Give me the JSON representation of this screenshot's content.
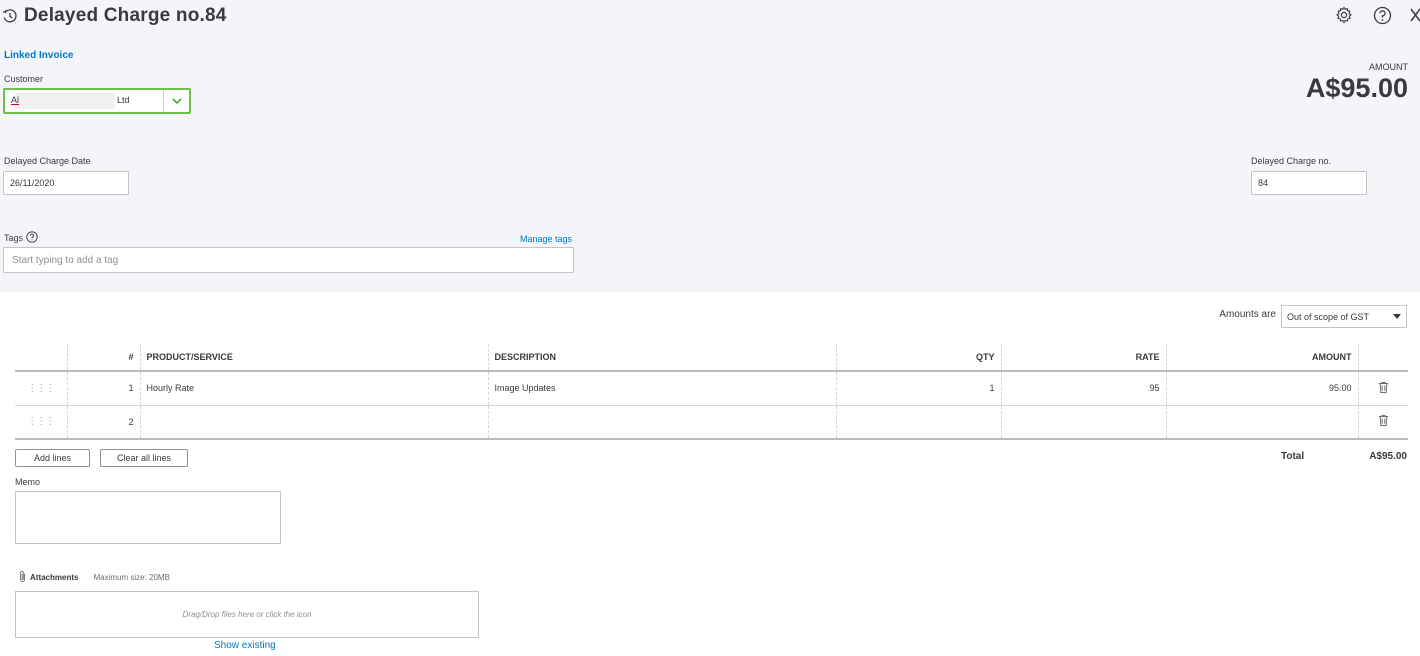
{
  "title": "Delayed Charge no.84",
  "linked_invoice": "Linked Invoice",
  "customer": {
    "label": "Customer",
    "value_start": "Al",
    "value_end": "Ltd"
  },
  "amount": {
    "label": "AMOUNT",
    "value": "A$95.00"
  },
  "charge_date": {
    "label": "Delayed Charge Date",
    "value": "26/11/2020"
  },
  "charge_no": {
    "label": "Delayed Charge no.",
    "value": "84"
  },
  "tags": {
    "label": "Tags",
    "manage": "Manage tags",
    "placeholder": "Start typing to add a tag"
  },
  "amounts_are": {
    "label": "Amounts are",
    "value": "Out of scope of GST"
  },
  "table": {
    "headers": {
      "num": "#",
      "product": "PRODUCT/SERVICE",
      "description": "DESCRIPTION",
      "qty": "QTY",
      "rate": "RATE",
      "amount": "AMOUNT"
    },
    "rows": [
      {
        "num": "1",
        "product": "Hourly Rate",
        "description": "Image Updates",
        "qty": "1",
        "rate": "95",
        "amount": "95.00"
      },
      {
        "num": "2",
        "product": "",
        "description": "",
        "qty": "",
        "rate": "",
        "amount": ""
      }
    ]
  },
  "buttons": {
    "add_lines": "Add lines",
    "clear_lines": "Clear all lines"
  },
  "total": {
    "label": "Total",
    "value": "A$95.00"
  },
  "memo": {
    "label": "Memo"
  },
  "attachments": {
    "title": "Attachments",
    "max_size": "Maximum size: 20MB",
    "drop_text": "Drag/Drop files here or click the icon",
    "show_existing": "Show existing"
  },
  "icons": {
    "history": "history-icon",
    "settings": "gear-icon",
    "help": "help-icon",
    "close": "close-icon",
    "trash": "trash-icon",
    "drag": "drag-handle-icon",
    "paperclip": "paperclip-icon"
  },
  "colors": {
    "link": "#0077c5",
    "customer_border": "#6cc04a",
    "header_bg": "#f4f5f8"
  }
}
